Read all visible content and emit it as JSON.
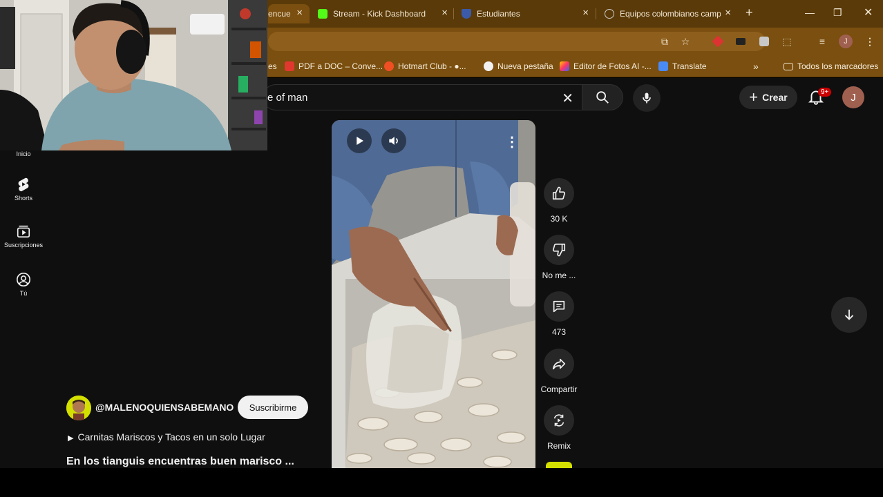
{
  "browser": {
    "tabs": [
      {
        "title": "encue",
        "favicon": "youtube-icon",
        "color": "#ff0000",
        "active": true
      },
      {
        "title": "Stream - Kick Dashboard",
        "favicon": "kick-icon",
        "color": "#53fc18",
        "active": false
      },
      {
        "title": "Estudiantes",
        "favicon": "shield-icon",
        "color": "#3b5ba9",
        "active": false
      },
      {
        "title": "Equipos colombianos camp",
        "favicon": "globe-icon",
        "color": "#cfcfcf",
        "active": false
      }
    ],
    "bookmarks": [
      {
        "label": "es",
        "icon": "folder-icon"
      },
      {
        "label": "PDF a DOC – Conve...",
        "icon": "pdf-icon"
      },
      {
        "label": "Hotmart Club - ●...",
        "icon": "hotmart-icon"
      },
      {
        "label": "Nueva pestaña",
        "icon": "globe-icon"
      },
      {
        "label": "Editor de Fotos AI -...",
        "icon": "photo-editor-icon"
      },
      {
        "label": "Translate",
        "icon": "translate-icon"
      },
      {
        "label": "»",
        "icon": "overflow-icon"
      },
      {
        "label": "Todos los marcadores",
        "icon": "folder-icon"
      }
    ],
    "profile_initial": "J"
  },
  "youtube": {
    "search": {
      "query": "e of man"
    },
    "create_label": "Crear",
    "notification_badge": "9+",
    "account_initial": "J",
    "sidebar": [
      {
        "label": "Inicio",
        "icon": "home-icon"
      },
      {
        "label": "Shorts",
        "icon": "shorts-icon"
      },
      {
        "label": "Suscripciones",
        "icon": "subscriptions-icon"
      },
      {
        "label": "Tú",
        "icon": "you-icon"
      }
    ],
    "actions": {
      "like_count": "30 K",
      "dislike_label": "No me ...",
      "comments_count": "473",
      "share_label": "Compartir",
      "remix_label": "Remix"
    },
    "video": {
      "channel": "@MALENOQUIENSABEMANO",
      "subscribe_label": "Suscribirme",
      "playlist": "Carnitas Mariscos y Tacos en un solo Lugar",
      "title": "En los tianguis encuentras buen marisco ..."
    }
  }
}
